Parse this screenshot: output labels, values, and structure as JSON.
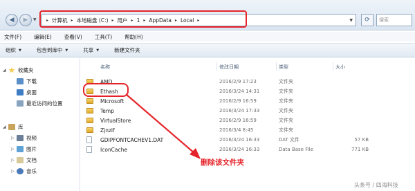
{
  "address": {
    "crumbs": [
      "计算机",
      "本地磁盘 (C:)",
      "用户",
      "1",
      "AppData",
      "Local"
    ]
  },
  "refresh_glyph": "⟳",
  "search_placeholder": "搜索",
  "menu": [
    "文件(F)",
    "编辑(E)",
    "查看(V)",
    "工具(T)",
    "帮助(H)"
  ],
  "toolbar": {
    "organize": "组织",
    "include": "包含到库中",
    "share": "共享",
    "new_folder": "新建文件夹"
  },
  "sidebar": {
    "favorites": "收藏夹",
    "downloads": "下载",
    "desktop": "桌面",
    "recent": "最近访问的位置",
    "libraries": "库",
    "videos": "视频",
    "pictures": "图片",
    "documents": "文档",
    "music": "音乐"
  },
  "columns": {
    "name": "名称",
    "date": "修改日期",
    "type": "类型",
    "size": "大小"
  },
  "files": [
    {
      "name": "AMD",
      "date": "2016/2/9 17:23",
      "type": "文件夹",
      "size": "",
      "icon": "folder-icon"
    },
    {
      "name": "Ethash",
      "date": "2016/3/24 14:31",
      "type": "文件夹",
      "size": "",
      "icon": "folder-icon"
    },
    {
      "name": "Microsoft",
      "date": "2016/2/9 16:59",
      "type": "文件夹",
      "size": "",
      "icon": "folder-icon"
    },
    {
      "name": "Temp",
      "date": "2016/3/24 17:33",
      "type": "文件夹",
      "size": "",
      "icon": "folder-icon"
    },
    {
      "name": "VirtualStore",
      "date": "2016/2/9 16:59",
      "type": "文件夹",
      "size": "",
      "icon": "folder-icon"
    },
    {
      "name": "Zjnzif",
      "date": "2016/3/4 8:45",
      "type": "文件夹",
      "size": "",
      "icon": "folder-icon"
    },
    {
      "name": "GDIPFONTCACHEV1.DAT",
      "date": "2016/3/24 16:33",
      "type": "DAT 文件",
      "size": "57 KB",
      "icon": "file-icon"
    },
    {
      "name": "IconCache",
      "date": "2016/3/24 16:33",
      "type": "Data Base File",
      "size": "771 KB",
      "icon": "file-icon"
    }
  ],
  "annotation": "删除该文件夹",
  "watermark": "头条号 / 四海科技",
  "colors": {
    "highlight": "#e5232a",
    "folder": "#e8b53e"
  }
}
